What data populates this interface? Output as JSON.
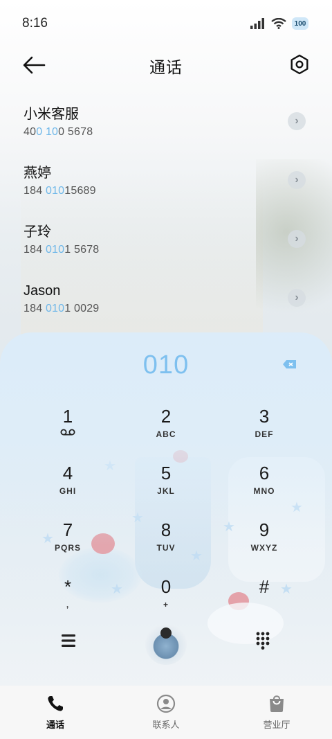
{
  "status_bar": {
    "time": "8:16",
    "battery": "100",
    "icons": [
      "signal-icon",
      "wifi-icon",
      "battery-icon"
    ]
  },
  "header": {
    "title": "通话",
    "back_icon": "back-arrow-icon",
    "settings_icon": "settings-hexagon-icon"
  },
  "calls": [
    {
      "name": "小米客服",
      "number_parts": [
        "40",
        "0 10",
        "0 5678"
      ]
    },
    {
      "name": "燕婷",
      "number_parts": [
        "184 ",
        "010",
        "15689"
      ]
    },
    {
      "name": "子玲",
      "number_parts": [
        "184 ",
        "010",
        "1 5678"
      ]
    },
    {
      "name": "Jason",
      "number_parts": [
        "184 ",
        "010",
        "1 0029"
      ]
    }
  ],
  "dialpad": {
    "input": "010",
    "keys": [
      {
        "digit": "1",
        "letters": ""
      },
      {
        "digit": "2",
        "letters": "ABC"
      },
      {
        "digit": "3",
        "letters": "DEF"
      },
      {
        "digit": "4",
        "letters": "GHI"
      },
      {
        "digit": "5",
        "letters": "JKL"
      },
      {
        "digit": "6",
        "letters": "MNO"
      },
      {
        "digit": "7",
        "letters": "PQRS"
      },
      {
        "digit": "8",
        "letters": "TUV"
      },
      {
        "digit": "9",
        "letters": "WXYZ"
      },
      {
        "digit": "*",
        "letters": ","
      },
      {
        "digit": "0",
        "letters": "+"
      },
      {
        "digit": "#",
        "letters": ""
      }
    ]
  },
  "bottom_nav": [
    {
      "label": "通话",
      "icon": "phone-icon",
      "active": true
    },
    {
      "label": "联系人",
      "icon": "contacts-icon",
      "active": false
    },
    {
      "label": "营业厅",
      "icon": "shopping-bag-icon",
      "active": false
    }
  ],
  "colors": {
    "accent": "#6eb7e9",
    "dial_display": "#7ec0ef"
  }
}
